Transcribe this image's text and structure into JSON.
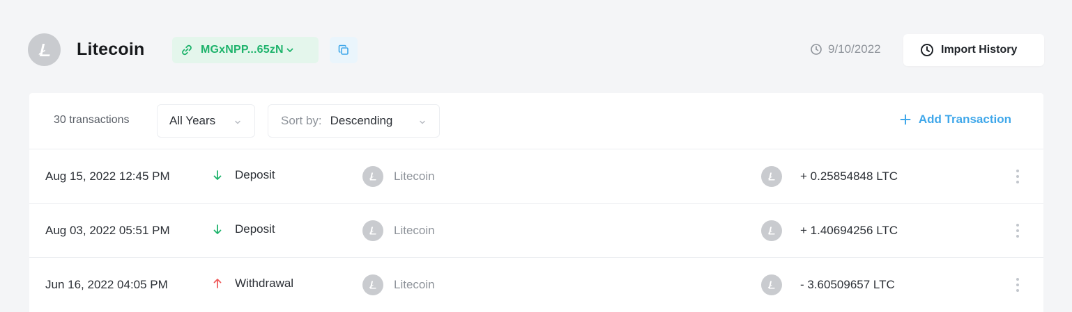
{
  "header": {
    "coin_name": "Litecoin",
    "address_short": "MGxNPP...65zN",
    "sync_date": "9/10/2022",
    "import_button_label": "Import History"
  },
  "toolbar": {
    "transaction_count": "30 transactions",
    "year_filter": {
      "selected": "All Years"
    },
    "sort": {
      "prefix": "Sort by:",
      "selected": "Descending"
    },
    "add_transaction_label": "Add Transaction"
  },
  "transactions": [
    {
      "date": "Aug 15, 2022 12:45 PM",
      "type": "Deposit",
      "direction": "in",
      "asset": "Litecoin",
      "amount": "+ 0.25854848 LTC"
    },
    {
      "date": "Aug 03, 2022 05:51 PM",
      "type": "Deposit",
      "direction": "in",
      "asset": "Litecoin",
      "amount": "+ 1.40694256 LTC"
    },
    {
      "date": "Jun 16, 2022 04:05 PM",
      "type": "Withdrawal",
      "direction": "out",
      "asset": "Litecoin",
      "amount": "- 3.60509657 LTC"
    }
  ],
  "icons": {
    "coin": "litecoin-icon",
    "address_link": "link-icon",
    "copy": "copy-icon",
    "clock": "clock-icon",
    "deposit": "arrow-down-icon",
    "withdrawal": "arrow-up-icon",
    "add": "plus-icon",
    "row_menu": "kebab-menu-icon"
  },
  "colors": {
    "accent_green": "#1db36b",
    "accent_blue": "#3fa7ea",
    "withdrawal_red": "#ef5b5b",
    "coin_gray": "#c9cbcf"
  }
}
